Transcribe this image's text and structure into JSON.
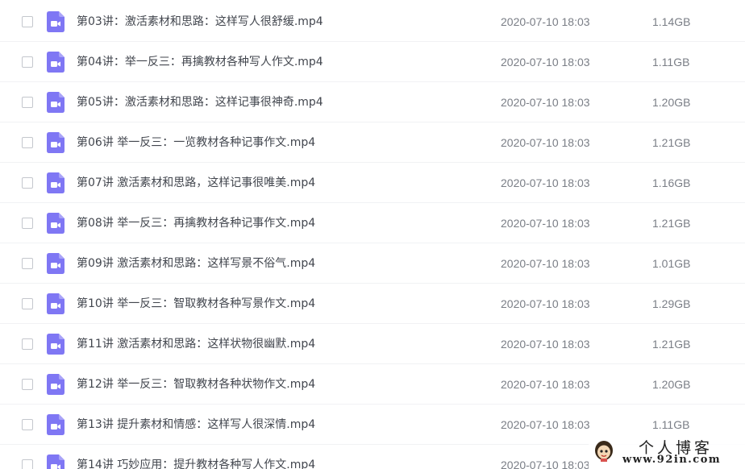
{
  "files": [
    {
      "name": "第03讲：激活素材和思路：这样写人很舒缓.mp4",
      "date": "2020-07-10 18:03",
      "size": "1.14GB",
      "icon": "video-file-icon"
    },
    {
      "name": "第04讲：举一反三：再擒教材各种写人作文.mp4",
      "date": "2020-07-10 18:03",
      "size": "1.11GB",
      "icon": "video-file-icon"
    },
    {
      "name": "第05讲：激活素材和思路：这样记事很神奇.mp4",
      "date": "2020-07-10 18:03",
      "size": "1.20GB",
      "icon": "video-file-icon"
    },
    {
      "name": "第06讲 举一反三：一览教材各种记事作文.mp4",
      "date": "2020-07-10 18:03",
      "size": "1.21GB",
      "icon": "video-file-icon"
    },
    {
      "name": "第07讲 激活素材和思路，这样记事很唯美.mp4",
      "date": "2020-07-10 18:03",
      "size": "1.16GB",
      "icon": "video-file-icon"
    },
    {
      "name": "第08讲 举一反三：再擒教材各种记事作文.mp4",
      "date": "2020-07-10 18:03",
      "size": "1.21GB",
      "icon": "video-file-icon"
    },
    {
      "name": "第09讲 激活素材和思路：这样写景不俗气.mp4",
      "date": "2020-07-10 18:03",
      "size": "1.01GB",
      "icon": "video-file-icon"
    },
    {
      "name": "第10讲 举一反三：智取教材各种写景作文.mp4",
      "date": "2020-07-10 18:03",
      "size": "1.29GB",
      "icon": "video-file-icon"
    },
    {
      "name": "第11讲 激活素材和思路：这样状物很幽默.mp4",
      "date": "2020-07-10 18:03",
      "size": "1.21GB",
      "icon": "video-file-icon"
    },
    {
      "name": "第12讲 举一反三：智取教材各种状物作文.mp4",
      "date": "2020-07-10 18:03",
      "size": "1.20GB",
      "icon": "video-file-icon"
    },
    {
      "name": "第13讲 提升素材和情感：这样写人很深情.mp4",
      "date": "2020-07-10 18:03",
      "size": "1.11GB",
      "icon": "video-file-icon"
    },
    {
      "name": "第14讲 巧妙应用：提升教材各种写人作文.mp4",
      "date": "2020-07-10 18:03",
      "size": "",
      "icon": "video-file-icon"
    }
  ],
  "colors": {
    "icon_bg": "#7f77f4",
    "icon_glyph": "#ffffff",
    "name_text": "#42464e",
    "meta_text": "#7a7e86",
    "divider": "#f1f2f4"
  },
  "watermark": {
    "title": "个人博客",
    "url": "www.92in.com"
  }
}
